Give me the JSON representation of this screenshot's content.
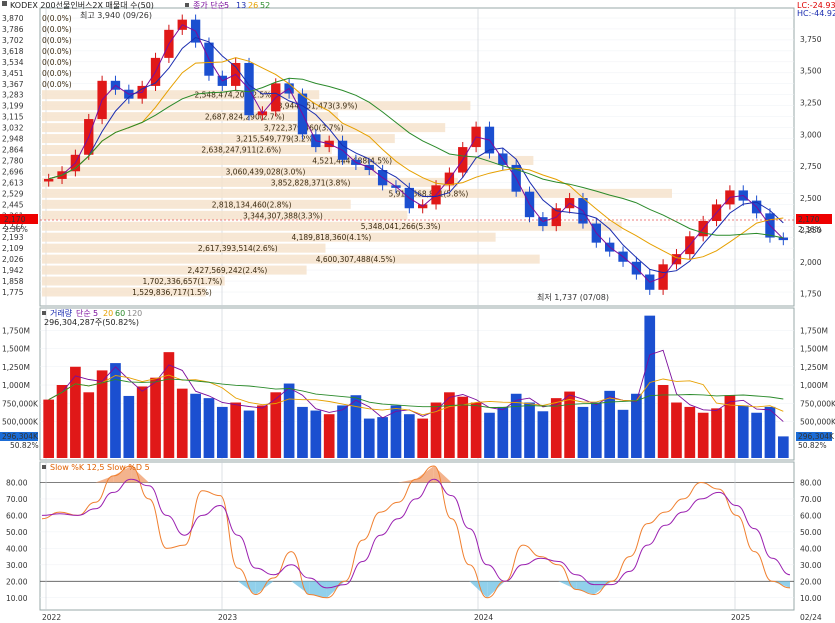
{
  "header": {
    "title": "KODEX 200선물인버스2X 매물대 수(50)",
    "ma_label": "종가 단순",
    "ma_periods": [
      "5",
      "13",
      "26",
      "52"
    ],
    "ma_colors": [
      "#7b0d9c",
      "#1b2db0",
      "#e6a000",
      "#2a8a2a"
    ]
  },
  "right_info": {
    "lc": "LC:-24.93",
    "hc": "HC:-44.92"
  },
  "price_panel": {
    "current_price": "2,170",
    "current_change": "2.36%",
    "y_ticks_left": [
      "3,870",
      "3,786",
      "3,702",
      "3,618",
      "3,534",
      "3,451",
      "3,367",
      "3,283",
      "3,199",
      "3,115",
      "3,032",
      "2,948",
      "2,864",
      "2,780",
      "2,696",
      "2,613",
      "2,529",
      "2,445",
      "2,361",
      "2,277",
      "2,193",
      "2,109",
      "2,026",
      "1,942",
      "1,858",
      "1,775"
    ],
    "y_ticks_right": [
      "3,750",
      "3,500",
      "3,250",
      "3,000",
      "2,750",
      "2,500",
      "2,250",
      "2,000",
      "1,750"
    ],
    "high_label": "최고 3,940 (09/26)",
    "low_label": "최저 1,737 (07/08)"
  },
  "volume_profile": [
    {
      "level": "3,870",
      "text": "0(0.0%)",
      "len": 0
    },
    {
      "level": "3,786",
      "text": "0(0.0%)",
      "len": 0
    },
    {
      "level": "3,702",
      "text": "0(0.0%)",
      "len": 0
    },
    {
      "level": "3,618",
      "text": "0(0.0%)",
      "len": 0
    },
    {
      "level": "3,534",
      "text": "0(0.0%)",
      "len": 0
    },
    {
      "level": "3,451",
      "text": "0(0.0%)",
      "len": 0
    },
    {
      "level": "3,367",
      "text": "0(0.0%)",
      "len": 0
    },
    {
      "level": "3,283",
      "text": "2,548,474,204(2.5%)",
      "len": 0.44
    },
    {
      "level": "3,199",
      "text": "3,944,251,473(3.9%)",
      "len": 0.68
    },
    {
      "level": "3,115",
      "text": "2,687,824,290(2.7%)",
      "len": 0.47
    },
    {
      "level": "3,032",
      "text": "3,722,379,460(3.7%)",
      "len": 0.64
    },
    {
      "level": "2,948",
      "text": "3,215,549,779(3.2%)",
      "len": 0.56
    },
    {
      "level": "2,864",
      "text": "2,638,247,911(2.6%)",
      "len": 0.46
    },
    {
      "level": "2,780",
      "text": "4,521,444,688(4.5%)",
      "len": 0.78
    },
    {
      "level": "2,696",
      "text": "3,060,439,028(3.0%)",
      "len": 0.53
    },
    {
      "level": "2,613",
      "text": "3,852,828,371(3.8%)",
      "len": 0.66
    },
    {
      "level": "2,529",
      "text": "5,914,668,871(5.8%)",
      "len": 1.0
    },
    {
      "level": "2,445",
      "text": "2,818,134,460(2.8%)",
      "len": 0.49
    },
    {
      "level": "2,361",
      "text": "3,344,307,388(3.3%)",
      "len": 0.58
    },
    {
      "level": "2,277",
      "text": "5,348,041,266(5.3%)",
      "len": 0.92
    },
    {
      "level": "2,193",
      "text": "4,189,818,360(4.1%)",
      "len": 0.72
    },
    {
      "level": "2,109",
      "text": "2,617,393,514(2.6%)",
      "len": 0.45
    },
    {
      "level": "2,026",
      "text": "4,600,307,488(4.5%)",
      "len": 0.79
    },
    {
      "level": "1,942",
      "text": "2,427,569,242(2.4%)",
      "len": 0.42
    },
    {
      "level": "1,858",
      "text": "1,702,336,657(1.7%)",
      "len": 0.29
    },
    {
      "level": "1,775",
      "text": "1,529,836,717(1.5%)",
      "len": 0.26
    }
  ],
  "volume_panel": {
    "title": "거래량",
    "ma_label": "단순",
    "ma_periods": [
      "5",
      "20",
      "60",
      "120"
    ],
    "current": "296,304,287주(50.82%)",
    "current_right": "296,304K",
    "current_pct": "50.82%",
    "y_ticks": [
      "1,750M",
      "1,500M",
      "1,250M",
      "1,000M",
      "750,000K",
      "500,000K"
    ]
  },
  "stoch_panel": {
    "title": "Slow %K 12,5  Slow %D 5",
    "y_ticks": [
      "80.00",
      "70.00",
      "60.00",
      "50.00",
      "40.00",
      "30.00",
      "20.00",
      "10.00"
    ]
  },
  "x_axis": {
    "labels": [
      "2022",
      "2023",
      "2024",
      "2025"
    ],
    "right_date": "02/24"
  },
  "chart_data": {
    "type": "candlestick",
    "title": "KODEX 200선물인버스2X",
    "price_range": [
      1737,
      3940
    ],
    "price_series": [
      2650,
      2710,
      2840,
      3120,
      3420,
      3350,
      3280,
      3380,
      3600,
      3820,
      3900,
      3720,
      3460,
      3380,
      3560,
      3150,
      3180,
      3400,
      3320,
      3000,
      2900,
      2950,
      2800,
      2760,
      2720,
      2600,
      2580,
      2420,
      2450,
      2600,
      2700,
      2900,
      3060,
      2850,
      2760,
      2550,
      2350,
      2280,
      2420,
      2500,
      2300,
      2150,
      2080,
      2000,
      1900,
      1780,
      1980,
      2060,
      2200,
      2320,
      2450,
      2560,
      2480,
      2380,
      2190,
      2170
    ],
    "high": {
      "value": 3940,
      "date": "09/26"
    },
    "low": {
      "value": 1737,
      "date": "07/08"
    },
    "volume_series": [
      800,
      1000,
      1250,
      900,
      1200,
      1300,
      850,
      980,
      1100,
      1450,
      950,
      880,
      820,
      700,
      760,
      650,
      720,
      900,
      1020,
      700,
      650,
      600,
      720,
      860,
      540,
      560,
      720,
      600,
      540,
      760,
      900,
      840,
      760,
      620,
      700,
      880,
      760,
      640,
      820,
      910,
      700,
      760,
      920,
      660,
      880,
      1950,
      1000,
      760,
      700,
      620,
      680,
      860,
      720,
      620,
      700,
      296
    ],
    "stoch_k": [
      58,
      62,
      60,
      68,
      84,
      90,
      70,
      40,
      42,
      75,
      72,
      28,
      12,
      22,
      38,
      12,
      10,
      20,
      45,
      62,
      68,
      82,
      90,
      58,
      30,
      10,
      20,
      42,
      35,
      30,
      15,
      12,
      20,
      35,
      55,
      62,
      70,
      80,
      76,
      60,
      38,
      20,
      16
    ],
    "stoch_d": [
      60,
      61,
      60,
      64,
      74,
      82,
      78,
      60,
      48,
      60,
      66,
      48,
      28,
      24,
      30,
      22,
      16,
      18,
      32,
      48,
      58,
      70,
      82,
      72,
      52,
      30,
      20,
      30,
      34,
      32,
      24,
      18,
      18,
      26,
      42,
      54,
      62,
      70,
      74,
      66,
      52,
      34,
      24
    ]
  }
}
